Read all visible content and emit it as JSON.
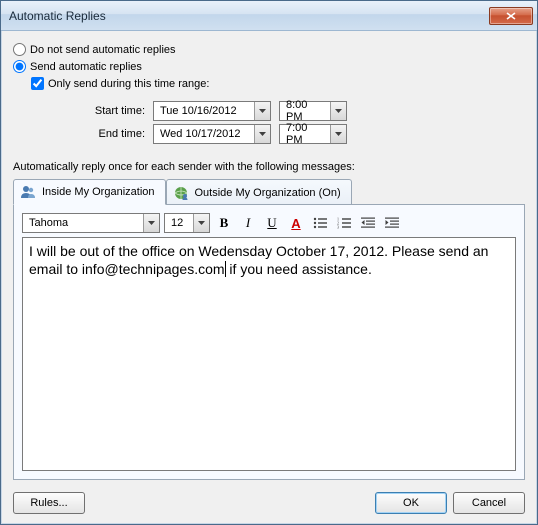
{
  "window": {
    "title": "Automatic Replies"
  },
  "options": {
    "dont_send_label": "Do not send automatic replies",
    "send_label": "Send automatic replies",
    "only_range_label": "Only send during this time range:",
    "start_label": "Start time:",
    "end_label": "End time:",
    "start_date": "Tue 10/16/2012",
    "start_time": "8:00 PM",
    "end_date": "Wed 10/17/2012",
    "end_time": "7:00 PM"
  },
  "section_label": "Automatically reply once for each sender with the following messages:",
  "tabs": {
    "inside_label": "Inside My Organization",
    "outside_label": "Outside My Organization (On)"
  },
  "toolbar": {
    "font": "Tahoma",
    "size": "12",
    "bold": "B",
    "italic": "I",
    "underline": "U",
    "fontcolor": "A"
  },
  "message": "I will be out of the office on Wedensday October 17, 2012. Please send an email to info@technipages.com if you need assistance.",
  "message_part1": "I will be out of the office on Wedensday October 17, 2012. Please send an email to info@technipages.com",
  "message_part2": " if you need assistance.",
  "buttons": {
    "rules": "Rules...",
    "ok": "OK",
    "cancel": "Cancel"
  }
}
